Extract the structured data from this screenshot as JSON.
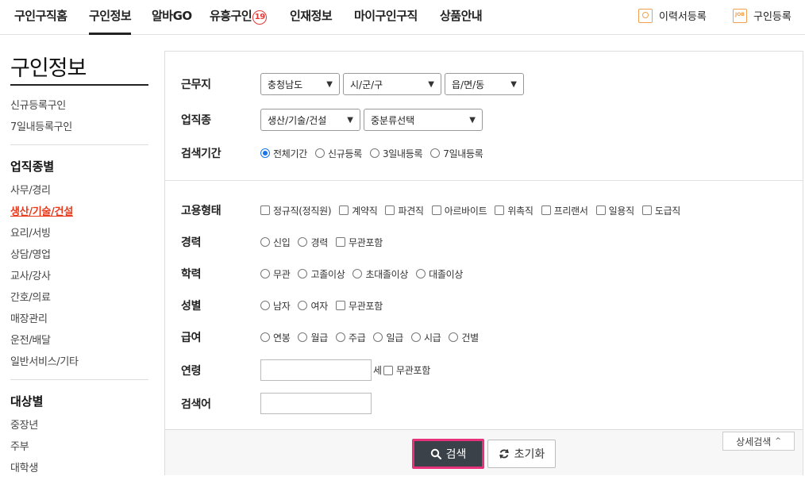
{
  "nav": {
    "items": [
      "구인구직홈",
      "구인정보",
      "알바GO",
      "유흥구인",
      "인재정보",
      "마이구인구직",
      "상품안내"
    ],
    "badge": "19",
    "resume_label": "이력서등록",
    "job_label": "구인등록",
    "job_icon_text": "JOB"
  },
  "sidebar": {
    "title": "구인정보",
    "top_links": [
      "신규등록구인",
      "7일내등록구인"
    ],
    "section1_title": "업직종별",
    "section1_links": [
      "사무/경리",
      "생산/기술/건설",
      "요리/서빙",
      "상담/영업",
      "교사/강사",
      "간호/의료",
      "매장관리",
      "운전/배달",
      "일반서비스/기타"
    ],
    "section2_title": "대상별",
    "section2_links": [
      "중장년",
      "주부",
      "대학생"
    ]
  },
  "form": {
    "location_label": "근무지",
    "loc_sido": "충청남도",
    "loc_sigungu": "시/군/구",
    "loc_dong": "읍/면/동",
    "jobtype_label": "업직종",
    "job_main": "생산/기술/건설",
    "job_sub": "중분류선택",
    "period_label": "검색기간",
    "period_options": [
      "전체기간",
      "신규등록",
      "3일내등록",
      "7일내등록"
    ],
    "employment_label": "고용형태",
    "employment_options": [
      "정규직(정직원)",
      "계약직",
      "파견직",
      "아르바이트",
      "위촉직",
      "프리랜서",
      "일용직",
      "도급직"
    ],
    "career_label": "경력",
    "career_options": [
      "신입",
      "경력"
    ],
    "career_any": "무관포함",
    "edu_label": "학력",
    "edu_options": [
      "무관",
      "고졸이상",
      "초대졸이상",
      "대졸이상"
    ],
    "gender_label": "성별",
    "gender_options": [
      "남자",
      "여자"
    ],
    "gender_any": "무관포함",
    "salary_label": "급여",
    "salary_options": [
      "연봉",
      "월급",
      "주급",
      "일급",
      "시급",
      "건별"
    ],
    "age_label": "연령",
    "age_unit": "세",
    "age_any": "무관포함",
    "keyword_label": "검색어",
    "search_button": "검색",
    "reset_button": "초기화",
    "detail_button": "상세검색"
  },
  "colors": {
    "accent_red": "#e8391b",
    "search_btn": "#3a4148",
    "search_border": "#e8317a",
    "radio_on": "#1a73e8"
  }
}
